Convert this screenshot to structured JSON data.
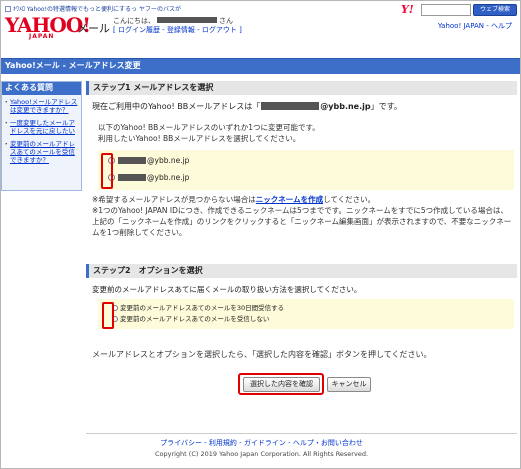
{
  "header": {
    "top_link": "ｷﾜﾒﾛ Yahoo!の特選情報でもっと便利にするっ ヤフーのバスが",
    "logo_text": "YAHOO!",
    "logo_sub": "JAPAN",
    "service_name": "メール",
    "greeting_prefix": "こんにちは、",
    "greeting_suffix": "さん",
    "account_links": "[ ログイン履歴 - 登録情報 - ログアウト ]",
    "right_links": "Yahoo! JAPAN - ヘルプ",
    "search_button": "ウェブ検索"
  },
  "title_bar": "Yahoo!メール - メールアドレス変更",
  "sidebar": {
    "title": "よくある質問",
    "items": [
      {
        "label": "Yahoo!メールアドレスは変更できますか？"
      },
      {
        "label": "一度変更したメールアドレスを元に戻したい"
      },
      {
        "label": "変更前のメールアドレスあてのメールを受信できますか？"
      }
    ]
  },
  "step1": {
    "heading": "ステップ1 メールアドレスを選択",
    "current_prefix": "現在ご利用中のYahoo! BBメールアドレスは「",
    "current_domain": "@ybb.ne.jp",
    "current_suffix": "」です。",
    "instruction_1": "以下のYahoo! BBメールアドレスのいずれか1つに変更可能です。",
    "instruction_2": "利用したいYahoo! BBメールアドレスを選択してください。",
    "choices": [
      {
        "domain": "@ybb.ne.jp"
      },
      {
        "domain": "@ybb.ne.jp"
      }
    ],
    "note_1_prefix": "※希望するメールアドレスが見つからない場合は",
    "note_1_link": "ニックネームを作成",
    "note_1_suffix": "してください。",
    "note_2": "※1つのYahoo! JAPAN IDにつき、作成できるニックネームは5つまでです。ニックネームをすでに5つ作成している場合は、上記の「ニックネームを作成」のリンクをクリックすると「ニックネーム編集画面」が表示されますので、不要なニックネームを1つ削除してください。"
  },
  "step2": {
    "heading": "ステップ2　オプションを選択",
    "description": "変更前のメールアドレスあてに届くメールの取り扱い方法を選択してください。",
    "options": [
      {
        "label": "変更前のメールアドレスあてのメールを30日間受信する"
      },
      {
        "label": "変更前のメールアドレスあてのメールを受信しない"
      }
    ]
  },
  "confirm": {
    "description": "メールアドレスとオプションを選択したら、「選択した内容を確認」ボタンを押してください。",
    "confirm_button": "選択した内容を確認",
    "cancel_button": "キャンセル"
  },
  "footer": {
    "links": "プライバシー - 利用規約 - ガイドライン - ヘルプ・お問い合わせ",
    "copyright": "Copyright (C) 2019 Yahoo Japan Corporation. All Rights Reserved."
  },
  "colors": {
    "title_bar": "#3d6fc9",
    "highlight": "#e00000",
    "choice_background": "#fdfbd9",
    "logo": "#e00020"
  }
}
